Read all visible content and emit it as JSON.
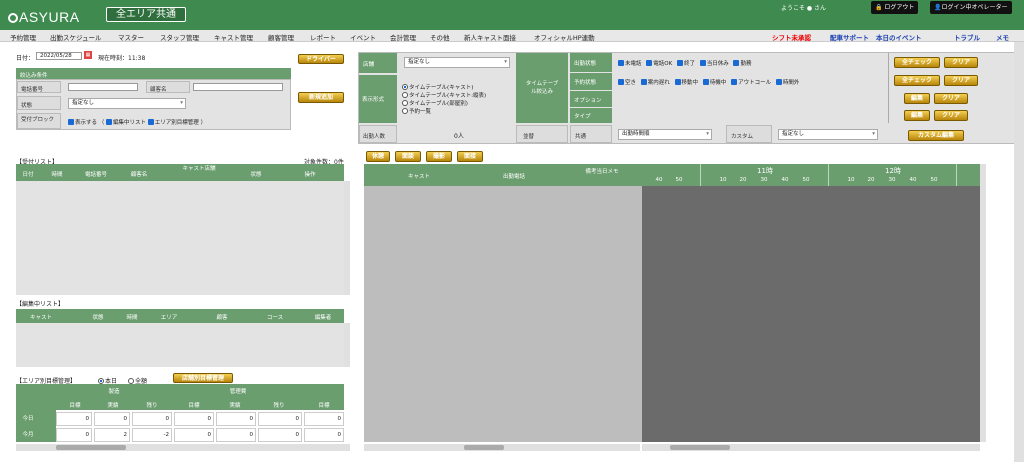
{
  "header": {
    "logo": "ASYURA",
    "area_button": "全エリア共通",
    "welcome": "ようこそ ● さん",
    "logout": "ログアウト",
    "operator": "ログイン中オペレーター"
  },
  "nav": {
    "items": [
      "予約管理",
      "出勤スケジュール",
      "マスター",
      "スタッフ管理",
      "キャスト管理",
      "顧客管理",
      "レポート",
      "イベント",
      "会計管理",
      "その他",
      "新人キャスト面接",
      "オフィシャルHP連動"
    ],
    "right": [
      "シフト未承認",
      "配車サポート",
      "本日のイベント",
      "トラブル",
      "メモ"
    ]
  },
  "left": {
    "date_label": "日付：",
    "date_value": "2022/05/28",
    "calendar_icon": "calendar-icon",
    "time_label": "現在時刻：11:38",
    "driver_btn": "ドライバー",
    "filter_title": "絞込み条件",
    "phone_label": "電話番号",
    "customer_label": "顧客名",
    "status_label": "状態",
    "status_value": "指定なし",
    "block_label": "受付ブロック",
    "block_opts": [
      "表示する",
      "（",
      "編集中リスト",
      "エリア別目標管理",
      "）"
    ],
    "new_btn": "新規追加",
    "reception_title": "【受付リスト】",
    "count_label": "対象件数：0件",
    "reception_cols": [
      "日付",
      "時間",
      "電話番号",
      "顧客名",
      "キャスト店舗",
      "状態",
      "操作"
    ],
    "editing_title": "【編集中リスト】",
    "editing_cols": [
      "キャスト",
      "状態",
      "時間",
      "エリア",
      "顧客",
      "コース",
      "編集者"
    ],
    "target_title": "【エリア別目標管理】",
    "radio_self": "本日",
    "radio_all": "全額",
    "target_btn": "店舗別目標管理",
    "groups": [
      "製造",
      "管理費"
    ],
    "sub_cols": [
      "目標",
      "実績",
      "残り",
      "目標",
      "実績",
      "残り",
      "目標"
    ],
    "rows": [
      {
        "label": "今日",
        "values": [
          "0",
          "0",
          "0",
          "0",
          "0",
          "0",
          "0"
        ]
      },
      {
        "label": "今月",
        "values": [
          "0",
          "2",
          "-2",
          "0",
          "0",
          "0",
          "0"
        ]
      }
    ]
  },
  "right": {
    "store_label": "店舗",
    "store_value": "指定なし",
    "display_label": "表示形式",
    "display_opts": [
      "タイムテーブル(キャスト)",
      "タイムテーブル(キャスト:縦表)",
      "タイムテーブル(部屋別)",
      "予約一覧"
    ],
    "timetable_label": "タイムテーブル絞込み",
    "attend_label": "出勤状態",
    "attend_opts": [
      "未電話",
      "電話OK",
      "終了",
      "当日休み",
      "勤務"
    ],
    "reserve_label": "予約状態",
    "reserve_opts": [
      "空き",
      "案内遅れ",
      "移動中",
      "待機中",
      "アウトコール",
      "時間外"
    ],
    "option_label": "オプション",
    "type_label": "タイプ",
    "count_label": "出勤人数",
    "count_value": "0人",
    "order_label": "並替",
    "common_label": "共通",
    "common_value": "出勤時間順",
    "custom_label": "カスタム",
    "custom_value": "指定なし",
    "all_check": "全チェック",
    "clear": "クリア",
    "edit": "編集",
    "custom_edit": "カスタム編集",
    "tabs": [
      "休憩",
      "面談",
      "撮影",
      "面接"
    ],
    "tt_cols": [
      "キャスト",
      "出勤電話",
      "備考当日メモ"
    ],
    "hours": [
      "",
      "11時",
      "12時"
    ],
    "minutes": [
      "40",
      "50",
      "10",
      "20",
      "30",
      "40",
      "50",
      "10",
      "20",
      "30",
      "40",
      "50"
    ]
  }
}
